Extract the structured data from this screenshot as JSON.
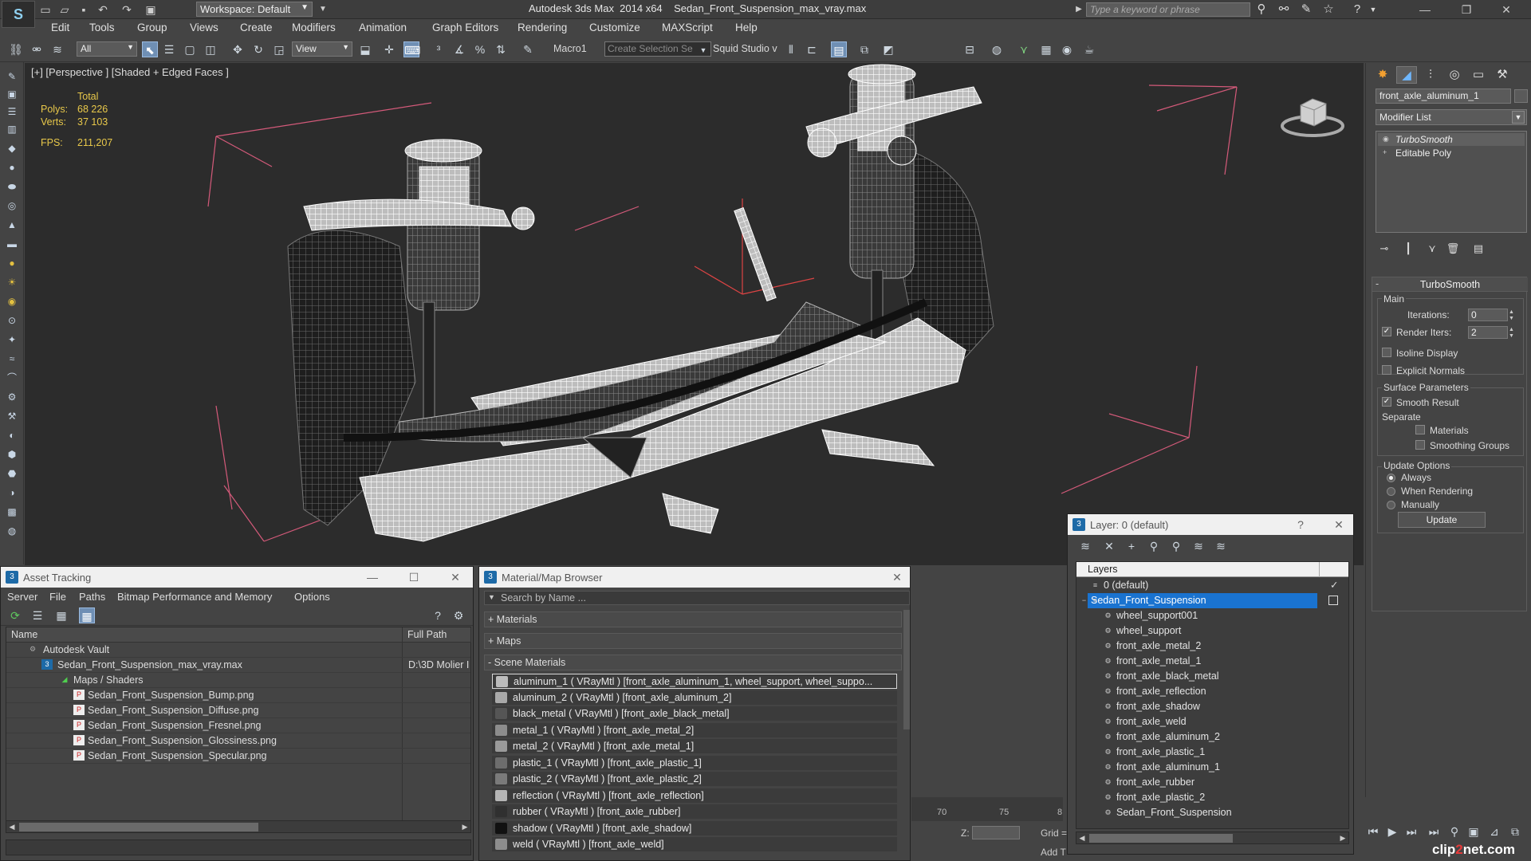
{
  "titlebar": {
    "workspace": "Workspace: Default",
    "app_title": "Autodesk 3ds Max  2014 x64    Sedan_Front_Suspension_max_vray.max",
    "search_placeholder": "Type a keyword or phrase"
  },
  "menu": [
    "Edit",
    "Tools",
    "Group",
    "Views",
    "Create",
    "Modifiers",
    "Animation",
    "Graph Editors",
    "Rendering",
    "Customize",
    "MAXScript",
    "Help"
  ],
  "toolbar": {
    "filter": "All",
    "ref_coord": "View",
    "macro": "Macro1",
    "named_selection": "Create Selection Se",
    "studio": "Squid Studio v"
  },
  "viewport": {
    "label": "[+] [Perspective ] [Shaded + Edged Faces ]",
    "stats": {
      "total_label": "Total",
      "polys_label": "Polys:",
      "polys": "68 226",
      "verts_label": "Verts:",
      "verts": "37 103",
      "fps_label": "FPS:",
      "fps": "211,207"
    }
  },
  "command_panel": {
    "object_name": "front_axle_aluminum_1",
    "modifier_list": "Modifier List",
    "stack": [
      "TurboSmooth",
      "Editable Poly"
    ],
    "rollout": {
      "title": "TurboSmooth",
      "main": "Main",
      "iterations_label": "Iterations:",
      "iterations": "0",
      "render_iters_label": "Render Iters:",
      "render_iters": "2",
      "isoline": "Isoline Display",
      "explicit_normals": "Explicit Normals",
      "surface_params": "Surface Parameters",
      "smooth_result": "Smooth Result",
      "separate": "Separate",
      "materials": "Materials",
      "smoothing_groups": "Smoothing Groups",
      "update_options": "Update Options",
      "always": "Always",
      "when_rendering": "When Rendering",
      "manually": "Manually",
      "update_button": "Update"
    }
  },
  "asset_tracking": {
    "title": "Asset Tracking",
    "menu": [
      "Server",
      "File",
      "Paths",
      "Bitmap Performance and Memory",
      "Options"
    ],
    "col_name": "Name",
    "col_path": "Full Path",
    "rows": [
      {
        "name": "Autodesk Vault",
        "path": ""
      },
      {
        "name": "Sedan_Front_Suspension_max_vray.max",
        "path": "D:\\3D Molier I"
      },
      {
        "name": "Maps / Shaders",
        "path": ""
      },
      {
        "name": "Sedan_Front_Suspension_Bump.png",
        "path": ""
      },
      {
        "name": "Sedan_Front_Suspension_Diffuse.png",
        "path": ""
      },
      {
        "name": "Sedan_Front_Suspension_Fresnel.png",
        "path": ""
      },
      {
        "name": "Sedan_Front_Suspension_Glossiness.png",
        "path": ""
      },
      {
        "name": "Sedan_Front_Suspension_Specular.png",
        "path": ""
      }
    ]
  },
  "material_browser": {
    "title": "Material/Map Browser",
    "search_placeholder": "Search by Name ...",
    "groups": [
      "+ Materials",
      "+ Maps",
      "- Scene Materials"
    ],
    "items": [
      "aluminum_1  ( VRayMtl )  [front_axle_aluminum_1, wheel_support, wheel_suppo...",
      "aluminum_2  ( VRayMtl )  [front_axle_aluminum_2]",
      "black_metal  ( VRayMtl )  [front_axle_black_metal]",
      "metal_1  ( VRayMtl )  [front_axle_metal_2]",
      "metal_2  ( VRayMtl )  [front_axle_metal_1]",
      "plastic_1  ( VRayMtl )  [front_axle_plastic_1]",
      "plastic_2  ( VRayMtl )  [front_axle_plastic_2]",
      "reflection  ( VRayMtl )  [front_axle_reflection]",
      "rubber  ( VRayMtl )  [front_axle_rubber]",
      "shadow  ( VRayMtl )  [front_axle_shadow]",
      "weld  ( VRayMtl )  [front_axle_weld]"
    ]
  },
  "timeline": {
    "ticks": [
      "70",
      "75",
      "8"
    ],
    "z_label": "Z:",
    "grid_label": "Grid =",
    "add_label": "Add T"
  },
  "layer_panel": {
    "title": "Layer: 0 (default)",
    "header": "Layers",
    "rows": [
      "0 (default)",
      "Sedan_Front_Suspension",
      "wheel_support001",
      "wheel_support",
      "front_axle_metal_2",
      "front_axle_metal_1",
      "front_axle_black_metal",
      "front_axle_reflection",
      "front_axle_shadow",
      "front_axle_weld",
      "front_axle_aluminum_2",
      "front_axle_plastic_1",
      "front_axle_aluminum_1",
      "front_axle_rubber",
      "front_axle_plastic_2",
      "Sedan_Front_Suspension"
    ]
  },
  "watermark": {
    "a": "clip",
    "b": "2",
    "c": "net.com"
  }
}
